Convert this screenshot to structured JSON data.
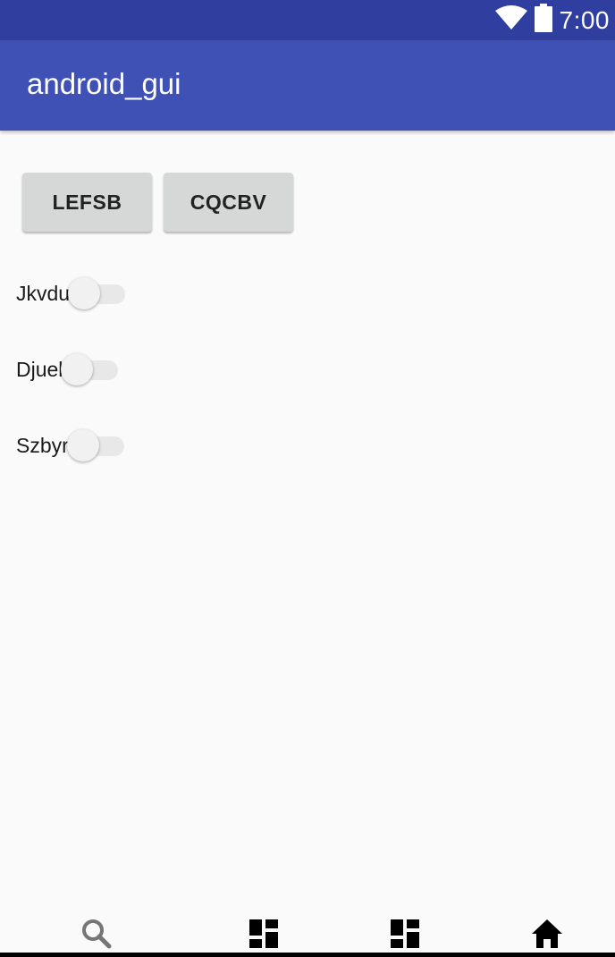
{
  "status_bar": {
    "time": "7:00",
    "icons": [
      "wifi-icon",
      "battery-icon"
    ],
    "background": "#303f9f"
  },
  "app_bar": {
    "title": "android_gui",
    "background": "#3f51b5"
  },
  "buttons": [
    {
      "label": "LEFSB"
    },
    {
      "label": "CQCBV"
    }
  ],
  "switches": [
    {
      "label": "Jkvdu",
      "checked": false
    },
    {
      "label": "Djuel",
      "checked": false
    },
    {
      "label": "Szbyr",
      "checked": false
    }
  ],
  "bottom_nav": {
    "items": [
      {
        "icon": "search-icon"
      },
      {
        "icon": "dashboard-icon"
      },
      {
        "icon": "dashboard-icon"
      },
      {
        "icon": "home-icon"
      }
    ]
  }
}
